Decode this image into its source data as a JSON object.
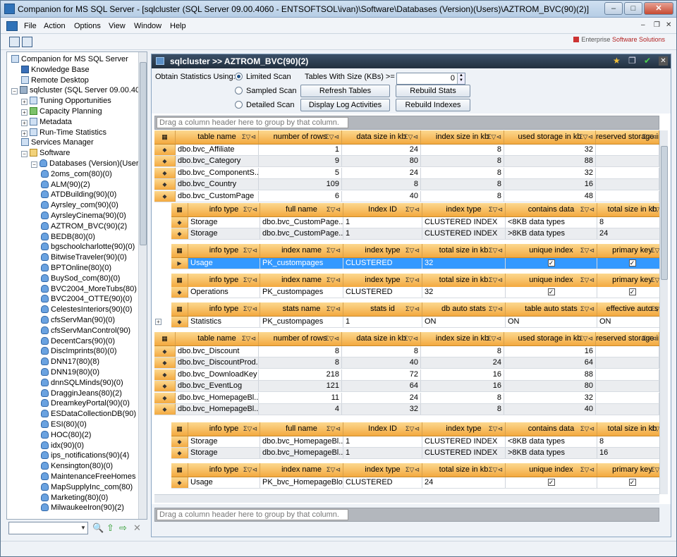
{
  "window": {
    "title": "Companion for MS SQL Server - [sqlcluster (SQL Server 09.00.4060 - ENTSOFTSOL\\ivan)\\Software\\Databases (Version)(Users)\\AZTROM_BVC(90)(2)]"
  },
  "menu": {
    "items": [
      "File",
      "Action",
      "Options",
      "View",
      "Window",
      "Help"
    ]
  },
  "logo": {
    "text_plain": "Enterprise ",
    "text_brand": "Software Solutions"
  },
  "tree": [
    {
      "label": "Companion for MS SQL Server",
      "icon": "app-icon",
      "exp": ""
    },
    {
      "label": "Knowledge Base",
      "icon": "book-icon",
      "exp": ""
    },
    {
      "label": "Remote Desktop",
      "icon": "desktop-icon",
      "exp": ""
    },
    {
      "label": "sqlcluster (SQL Server 09.00.4060",
      "icon": "server-icon",
      "exp": "−"
    },
    {
      "label": "Tuning Opportunities",
      "icon": "tuning-icon",
      "exp": "+"
    },
    {
      "label": "Capacity Planning",
      "icon": "chart-icon",
      "exp": "+"
    },
    {
      "label": "Metadata",
      "icon": "metadata-icon",
      "exp": "+"
    },
    {
      "label": "Run-Time Statistics",
      "icon": "stats-icon",
      "exp": "+"
    },
    {
      "label": "Services Manager",
      "icon": "services-icon",
      "exp": ""
    },
    {
      "label": "Software",
      "icon": "folder-icon",
      "exp": "−"
    },
    {
      "label": "Databases (Version)(Users)",
      "icon": "database-icon",
      "exp": "−"
    },
    {
      "label": "2oms_com(80)(0)",
      "icon": "database-icon",
      "exp": ""
    },
    {
      "label": "ALM(90)(2)",
      "icon": "database-icon",
      "exp": ""
    },
    {
      "label": "ATDBuilding(90)(0)",
      "icon": "database-icon",
      "exp": ""
    },
    {
      "label": "Ayrsley_com(90)(0)",
      "icon": "database-icon",
      "exp": ""
    },
    {
      "label": "AyrsleyCinema(90)(0)",
      "icon": "database-icon",
      "exp": ""
    },
    {
      "label": "AZTROM_BVC(90)(2)",
      "icon": "database-icon",
      "exp": ""
    },
    {
      "label": "BEDB(80)(0)",
      "icon": "database-icon",
      "exp": ""
    },
    {
      "label": "bgschoolcharlotte(90)(0)",
      "icon": "database-icon",
      "exp": ""
    },
    {
      "label": "BitwiseTraveler(90)(0)",
      "icon": "database-icon",
      "exp": ""
    },
    {
      "label": "BPTOnline(80)(0)",
      "icon": "database-icon",
      "exp": ""
    },
    {
      "label": "BuySod_com(80)(0)",
      "icon": "database-icon",
      "exp": ""
    },
    {
      "label": "BVC2004_MoreTubs(80)",
      "icon": "database-icon",
      "exp": ""
    },
    {
      "label": "BVC2004_OTTE(90)(0)",
      "icon": "database-icon",
      "exp": ""
    },
    {
      "label": "CelestesInteriors(90)(0)",
      "icon": "database-icon",
      "exp": ""
    },
    {
      "label": "cfsServMan(90)(0)",
      "icon": "database-icon",
      "exp": ""
    },
    {
      "label": "cfsServManControl(90)",
      "icon": "database-icon",
      "exp": ""
    },
    {
      "label": "DecentCars(90)(0)",
      "icon": "database-icon",
      "exp": ""
    },
    {
      "label": "DiscImprints(80)(0)",
      "icon": "database-icon",
      "exp": ""
    },
    {
      "label": "DNN17(80)(8)",
      "icon": "database-icon",
      "exp": ""
    },
    {
      "label": "DNN19(80)(0)",
      "icon": "database-icon",
      "exp": ""
    },
    {
      "label": "dnnSQLMinds(90)(0)",
      "icon": "database-icon",
      "exp": ""
    },
    {
      "label": "DragginJeans(80)(2)",
      "icon": "database-icon",
      "exp": ""
    },
    {
      "label": "DreamkeyPortal(90)(0)",
      "icon": "database-icon",
      "exp": ""
    },
    {
      "label": "ESDataCollectionDB(90)",
      "icon": "database-icon",
      "exp": ""
    },
    {
      "label": "ESI(80)(0)",
      "icon": "database-icon",
      "exp": ""
    },
    {
      "label": "HOC(80)(2)",
      "icon": "database-icon",
      "exp": ""
    },
    {
      "label": "idx(90)(0)",
      "icon": "database-icon",
      "exp": ""
    },
    {
      "label": "ips_notifications(90)(4)",
      "icon": "database-icon",
      "exp": ""
    },
    {
      "label": "Kensington(80)(0)",
      "icon": "database-icon",
      "exp": ""
    },
    {
      "label": "MaintenanceFreeHomes",
      "icon": "database-icon",
      "exp": ""
    },
    {
      "label": "MapSupplyInc_com(80)",
      "icon": "database-icon",
      "exp": ""
    },
    {
      "label": "Marketing(80)(0)",
      "icon": "database-icon",
      "exp": ""
    },
    {
      "label": "MilwaukeeIron(90)(2)",
      "icon": "database-icon",
      "exp": ""
    }
  ],
  "panel": {
    "title": "sqlcluster >> AZTROM_BVC(90)(2)",
    "obtain_label": "Obtain Statistics Using:",
    "radios": [
      "Limited Scan",
      "Sampled Scan",
      "Detailed Scan"
    ],
    "tables_size_label": "Tables With Size (KBs) >=",
    "tables_size_value": "0",
    "buttons": [
      "Refresh Tables",
      "Rebuild Stats",
      "Display Log Activities",
      "Rebuild Indexes"
    ],
    "group_hint": "Drag a column header here to group by that column.",
    "group_hint_bottom": "Drag a column header here to group by that column."
  },
  "grid": {
    "table_headers": [
      "table name",
      "number of rows",
      "data size in kb",
      "index size in kb",
      "used storage in kb",
      "reserved storage in"
    ],
    "rows1": [
      [
        "dbo.bvc_Affiliate",
        "1",
        "24",
        "8",
        "32"
      ],
      [
        "dbo.bvc_Category",
        "9",
        "80",
        "8",
        "88"
      ],
      [
        "dbo.bvc_ComponentS...",
        "5",
        "24",
        "8",
        "32"
      ],
      [
        "dbo.bvc_Country",
        "109",
        "8",
        "8",
        "16"
      ],
      [
        "dbo.bvc_CustomPage",
        "6",
        "40",
        "8",
        "48"
      ]
    ],
    "storage_headers": [
      "info type",
      "full name",
      "Index ID",
      "index type",
      "contains data",
      "total size in kb"
    ],
    "storage_rows1": [
      [
        "Storage",
        "dbo.bvc_CustomPage....",
        "1",
        "CLUSTERED INDEX",
        "<8KB data types",
        "8"
      ],
      [
        "Storage",
        "dbo.bvc_CustomPage....",
        "1",
        "CLUSTERED INDEX",
        ">8KB data types",
        "24"
      ]
    ],
    "usage_headers": [
      "info type",
      "index name",
      "index type",
      "total size in kb",
      "unique index",
      "primary key"
    ],
    "usage_row1": [
      "Usage",
      "PK_custompages",
      "CLUSTERED",
      "32"
    ],
    "ops_headers": [
      "info type",
      "index name",
      "index type",
      "total size in kb",
      "unique index",
      "primary key"
    ],
    "ops_row1": [
      "Operations",
      "PK_custompages",
      "CLUSTERED",
      "32"
    ],
    "stats_headers": [
      "info type",
      "stats name",
      "stats id",
      "db auto stats",
      "table auto stats",
      "effective auto s"
    ],
    "stats_row1": [
      "Statistics",
      "PK_custompages",
      "1",
      "ON",
      "ON",
      "ON"
    ],
    "rows2": [
      [
        "dbo.bvc_Discount",
        "8",
        "8",
        "8",
        "16"
      ],
      [
        "dbo.bvc_DiscountProd...",
        "8",
        "40",
        "24",
        "64"
      ],
      [
        "dbo.bvc_DownloadKey",
        "218",
        "72",
        "16",
        "88"
      ],
      [
        "dbo.bvc_EventLog",
        "121",
        "64",
        "16",
        "80"
      ],
      [
        "dbo.bvc_HomepageBl...",
        "11",
        "24",
        "8",
        "32"
      ],
      [
        "dbo.bvc_HomepageBl...",
        "4",
        "32",
        "8",
        "40"
      ]
    ],
    "storage_rows2": [
      [
        "Storage",
        "dbo.bvc_HomepageBl...",
        "1",
        "CLUSTERED INDEX",
        "<8KB data types",
        "8"
      ],
      [
        "Storage",
        "dbo.bvc_HomepageBl...",
        "1",
        "CLUSTERED INDEX",
        ">8KB data types",
        "16"
      ]
    ],
    "usage_row2": [
      "Usage",
      "PK_bvc_HomepageBlo...",
      "CLUSTERED",
      "24"
    ],
    "check_mark": "✓"
  }
}
